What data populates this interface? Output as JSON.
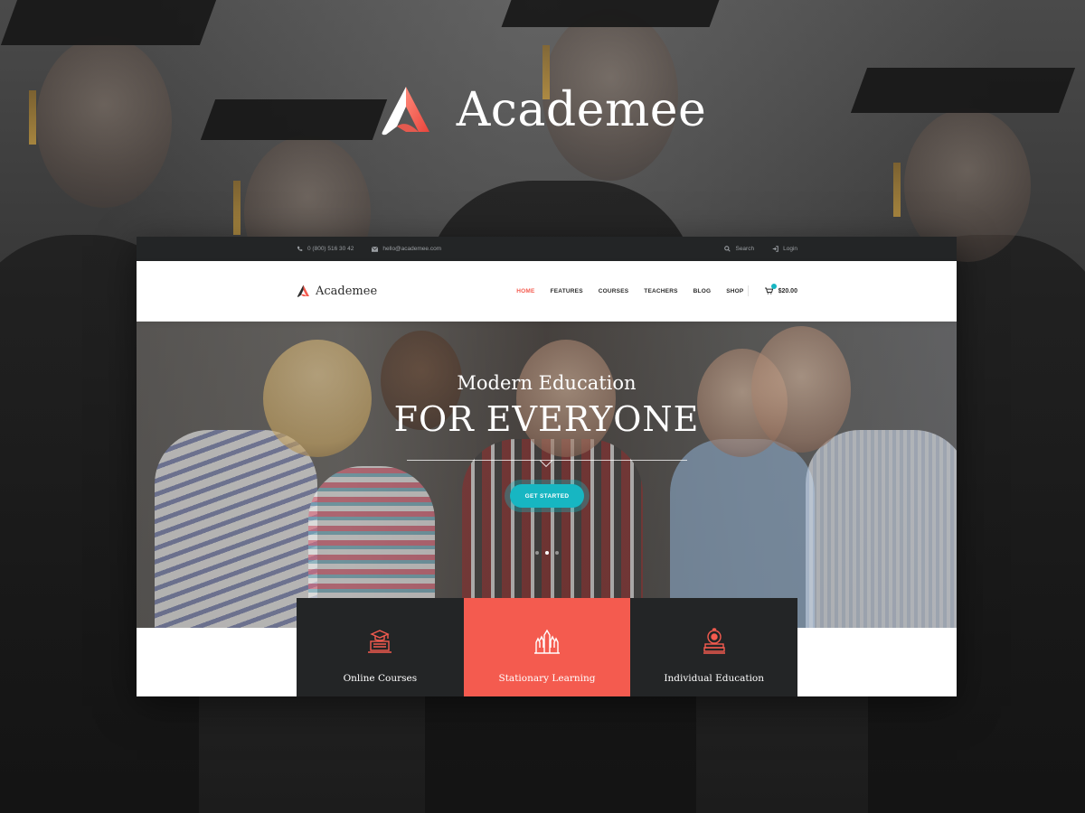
{
  "brand": {
    "name": "Academee",
    "accent": "#f45b4f",
    "teal": "#17b6c2",
    "dark": "#232526"
  },
  "topbar": {
    "phone": "0 (800) 516 30 42",
    "email": "hello@academee.com",
    "search_label": "Search",
    "login_label": "Login",
    "icons": [
      "phone-icon",
      "mail-icon",
      "search-icon",
      "login-icon"
    ]
  },
  "header": {
    "logo_text": "Academee",
    "nav": [
      {
        "label": "HOME",
        "active": true
      },
      {
        "label": "FEATURES",
        "active": false
      },
      {
        "label": "COURSES",
        "active": false
      },
      {
        "label": "TEACHERS",
        "active": false
      },
      {
        "label": "BLOG",
        "active": false
      },
      {
        "label": "SHOP",
        "active": false
      }
    ],
    "cart_total": "$20.00"
  },
  "hero": {
    "subtitle": "Modern Education",
    "title": "FOR EVERYONE",
    "cta_label": "GET STARTED",
    "slides": 3,
    "active_slide": 2
  },
  "features": [
    {
      "label": "Online Courses",
      "icon": "graduation-laptop-icon",
      "highlighted": false
    },
    {
      "label": "Stationary Learning",
      "icon": "raised-hands-icon",
      "highlighted": true
    },
    {
      "label": "Individual Education",
      "icon": "apple-books-icon",
      "highlighted": false
    }
  ]
}
